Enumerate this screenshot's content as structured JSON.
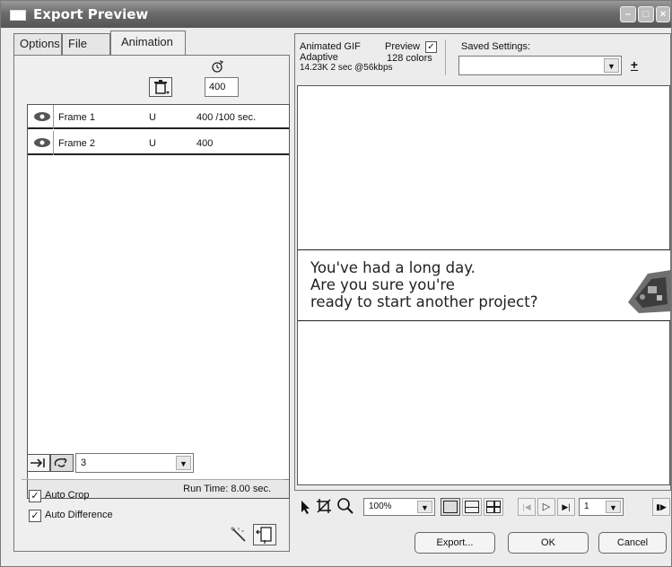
{
  "window": {
    "title": "Export Preview"
  },
  "tabs": [
    "Options",
    "File",
    "Animation"
  ],
  "animation": {
    "delay_value": "400",
    "frames": [
      {
        "name": "Frame 1",
        "disposal": "U",
        "delay": "400 /100 sec."
      },
      {
        "name": "Frame 2",
        "disposal": "U",
        "delay": "400"
      }
    ],
    "run_time": "Run Time: 8.00 sec.",
    "loop_count": "3",
    "auto_crop_label": "Auto Crop",
    "auto_difference_label": "Auto Difference"
  },
  "info": {
    "format": "Animated GIF",
    "palette": "Adaptive",
    "size": "14.23K  2 sec @56kbps",
    "preview_label": "Preview",
    "colors": "128 colors",
    "saved_settings_label": "Saved Settings:",
    "saved_settings_value": "",
    "add_icon": "+"
  },
  "banner": {
    "line1": "You've had a long day.",
    "line2": "Are you sure you're",
    "line3": "ready to start another project?"
  },
  "toolbar": {
    "zoom": "100%",
    "frame_number": "1"
  },
  "buttons": {
    "export": "Export...",
    "ok": "OK",
    "cancel": "Cancel"
  },
  "icons": {
    "trash": "trash-icon",
    "clock": "clock-icon",
    "eye": "eye-icon",
    "pointer": "pointer-icon",
    "crop": "crop-icon",
    "zoom": "magnifier-icon"
  }
}
